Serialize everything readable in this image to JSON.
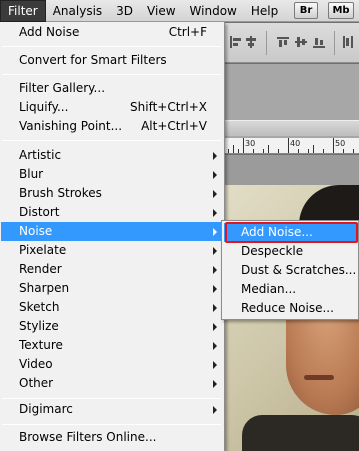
{
  "menubar": {
    "items": [
      "Filter",
      "Analysis",
      "3D",
      "View",
      "Window",
      "Help"
    ],
    "app_buttons": [
      "Br",
      "Mb"
    ]
  },
  "ruler": {
    "labels": [
      "30",
      "40",
      "50"
    ]
  },
  "filter_menu": {
    "last_filter": {
      "label": "Add Noise",
      "shortcut": "Ctrl+F"
    },
    "convert_smart": "Convert for Smart Filters",
    "filter_gallery": "Filter Gallery...",
    "liquify": {
      "label": "Liquify...",
      "shortcut": "Shift+Ctrl+X"
    },
    "vanishing_point": {
      "label": "Vanishing Point...",
      "shortcut": "Alt+Ctrl+V"
    },
    "categories": [
      "Artistic",
      "Blur",
      "Brush Strokes",
      "Distort",
      "Noise",
      "Pixelate",
      "Render",
      "Sharpen",
      "Sketch",
      "Stylize",
      "Texture",
      "Video",
      "Other"
    ],
    "digimarc": "Digimarc",
    "browse_online": "Browse Filters Online..."
  },
  "noise_submenu": {
    "items": [
      "Add Noise...",
      "Despeckle",
      "Dust & Scratches...",
      "Median...",
      "Reduce Noise..."
    ]
  },
  "colors": {
    "highlight": "#3399ff",
    "annotation_red": "#e2141e",
    "menu_bg": "#f1f1f1",
    "active_title_bg": "#3b3b3b"
  }
}
